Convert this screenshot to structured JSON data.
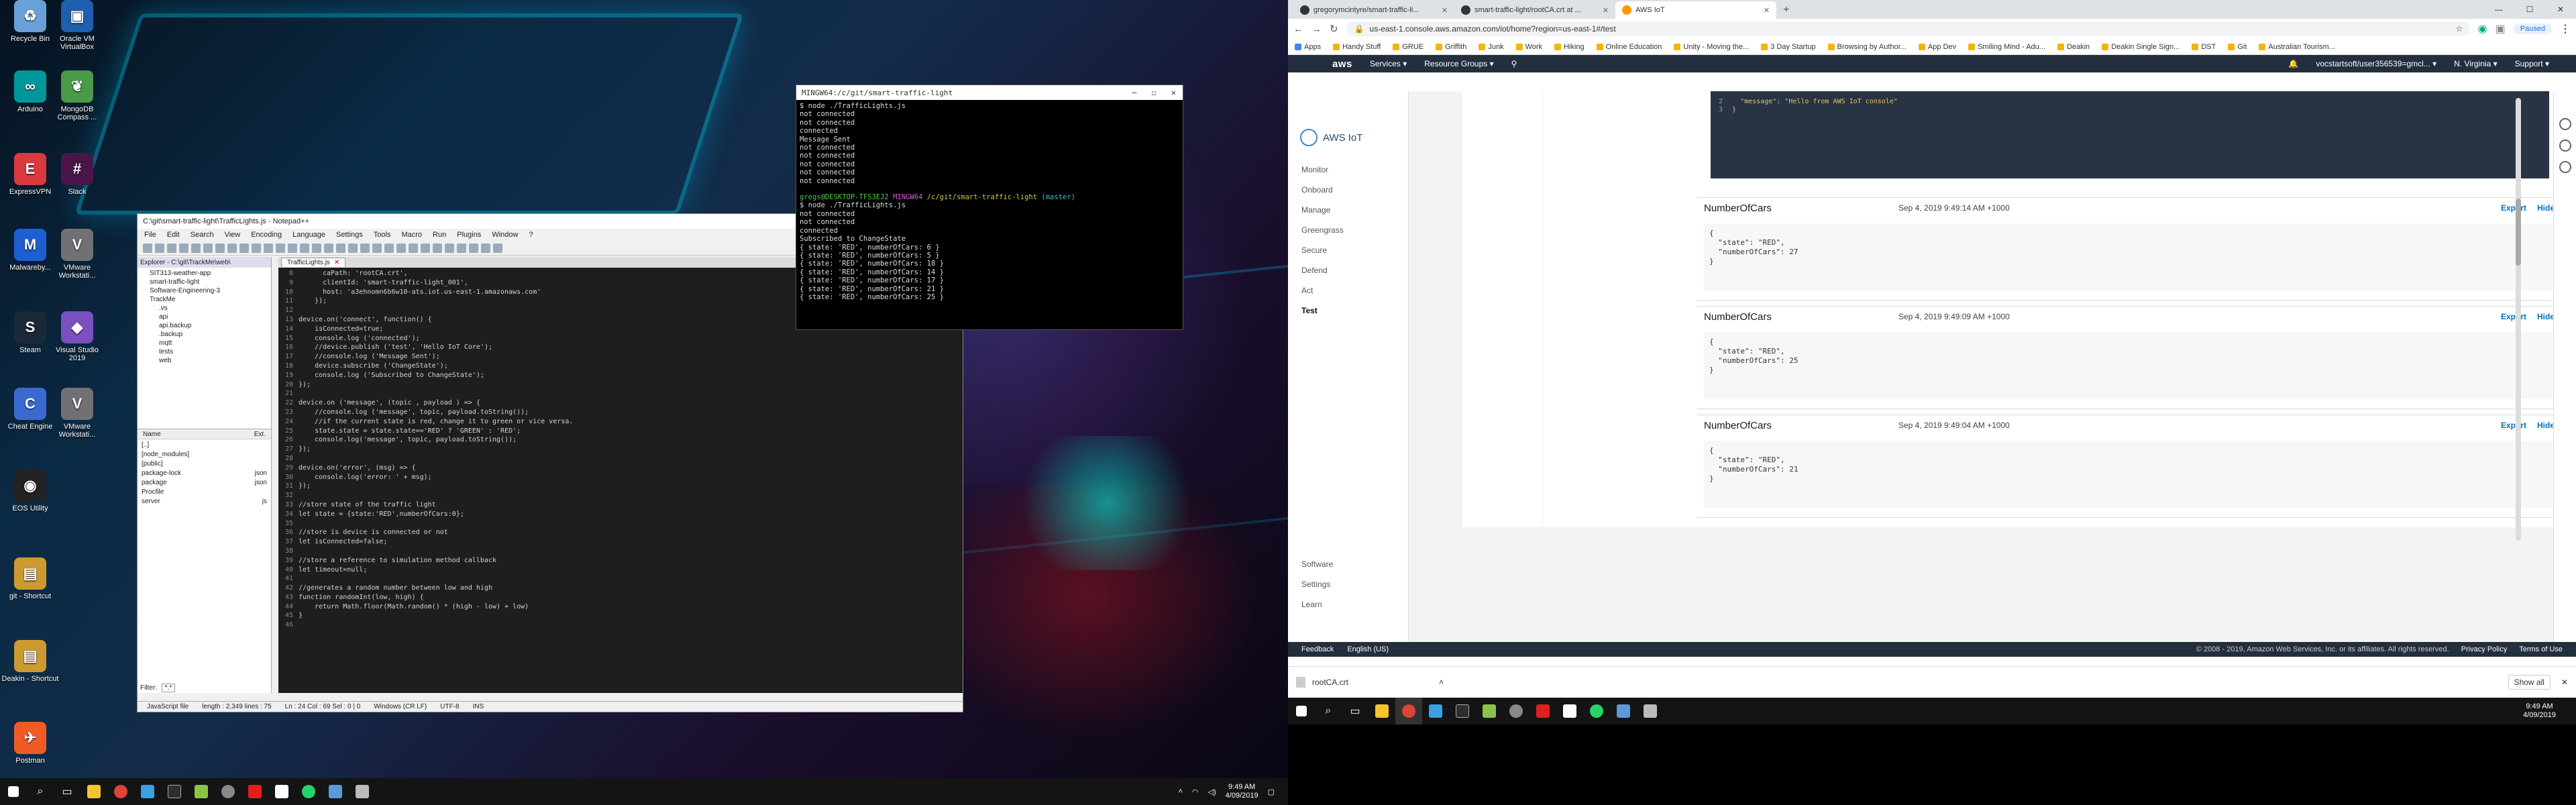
{
  "desktop": {
    "icons": [
      {
        "label": "Recycle Bin",
        "color": "#6aa0d8",
        "glyph": "♻"
      },
      {
        "label": "Oracle VM VirtualBox",
        "color": "#1f5fb0",
        "glyph": "▣"
      },
      {
        "label": "Arduino",
        "color": "#00979c",
        "glyph": "∞"
      },
      {
        "label": "MongoDB Compass ...",
        "color": "#4a9a4a",
        "glyph": "❦"
      },
      {
        "label": "ExpressVPN",
        "color": "#da3940",
        "glyph": "E"
      },
      {
        "label": "Slack",
        "color": "#4a154b",
        "glyph": "#"
      },
      {
        "label": "Malwareby...",
        "color": "#1d5fd0",
        "glyph": "M"
      },
      {
        "label": "VMware Workstati...",
        "color": "#717074",
        "glyph": "V"
      },
      {
        "label": "Steam",
        "color": "#1b2838",
        "glyph": "S"
      },
      {
        "label": "Visual Studio 2019",
        "color": "#7a4fc0",
        "glyph": "◆"
      },
      {
        "label": "VMware Workstati...",
        "color": "#717074",
        "glyph": "V"
      },
      {
        "label": "Cheat Engine",
        "color": "#3a6ad0",
        "glyph": "C"
      },
      {
        "label": "EOS Utility",
        "color": "#222",
        "glyph": "◉"
      },
      {
        "label": "git - Shortcut",
        "color": "#cc9a30",
        "glyph": "▤"
      },
      {
        "label": "Deakin - Shortcut",
        "color": "#cc9a30",
        "glyph": "▤"
      },
      {
        "label": "Postman",
        "color": "#ef5b25",
        "glyph": "✈"
      }
    ]
  },
  "terminal": {
    "title": "MINGW64:/c/git/smart-traffic-light",
    "lines": [
      {
        "cls": "",
        "text": "$ node ./TrafficLights.js"
      },
      {
        "cls": "",
        "text": "not connected"
      },
      {
        "cls": "",
        "text": "not connected"
      },
      {
        "cls": "",
        "text": "connected"
      },
      {
        "cls": "",
        "text": "Message Sent"
      },
      {
        "cls": "",
        "text": "not connected"
      },
      {
        "cls": "",
        "text": "not connected"
      },
      {
        "cls": "",
        "text": "not connected"
      },
      {
        "cls": "",
        "text": "not connected"
      },
      {
        "cls": "",
        "text": "not connected"
      },
      {
        "cls": "",
        "text": ""
      },
      {
        "cls": "prompt",
        "user": "gregs@DESKTOP-TFS3EJ2",
        "shell": "MINGW64",
        "path": "/c/git/smart-traffic-light",
        "branch": "(master)"
      },
      {
        "cls": "",
        "text": "$ node ./TrafficLights.js"
      },
      {
        "cls": "",
        "text": "not connected"
      },
      {
        "cls": "",
        "text": "not connected"
      },
      {
        "cls": "",
        "text": "connected"
      },
      {
        "cls": "",
        "text": "Subscribed to ChangeState"
      },
      {
        "cls": "",
        "text": "{ state: 'RED', numberOfCars: 6 }"
      },
      {
        "cls": "",
        "text": "{ state: 'RED', numberOfCars: 5 }"
      },
      {
        "cls": "",
        "text": "{ state: 'RED', numberOfCars: 18 }"
      },
      {
        "cls": "",
        "text": "{ state: 'RED', numberOfCars: 14 }"
      },
      {
        "cls": "",
        "text": "{ state: 'RED', numberOfCars: 17 }"
      },
      {
        "cls": "",
        "text": "{ state: 'RED', numberOfCars: 21 }"
      },
      {
        "cls": "",
        "text": "{ state: 'RED', numberOfCars: 25 }"
      }
    ]
  },
  "notepad": {
    "title": "C:\\git\\smart-traffic-light\\TrafficLights.js - Notepad++",
    "menu": [
      "File",
      "Edit",
      "Search",
      "View",
      "Encoding",
      "Language",
      "Settings",
      "Tools",
      "Macro",
      "Run",
      "Plugins",
      "Window",
      "?"
    ],
    "explorer_title": "Explorer - C:\\git\\TrackMe\\web\\",
    "tab_label": "TrafficLights.js",
    "tree": [
      "SIT313-weather-app",
      "smart-traffic-light",
      "Software-Engineering-3",
      "TrackMe",
      ".vs",
      "api",
      "api.backup",
      ".backup",
      "mqtt",
      "tests",
      "web"
    ],
    "files_head": {
      "name": "Name",
      "ext": "Ext."
    },
    "files": [
      {
        "name": "[..]",
        "ext": ""
      },
      {
        "name": "[node_modules]",
        "ext": ""
      },
      {
        "name": "[public]",
        "ext": ""
      },
      {
        "name": "package-lock",
        "ext": "json"
      },
      {
        "name": "package",
        "ext": "json"
      },
      {
        "name": "Procfile",
        "ext": ""
      },
      {
        "name": "server",
        "ext": "js"
      }
    ],
    "filter_label": "Filter:",
    "filter_value": "*.*",
    "code": [
      {
        "n": "8",
        "t": "      caPath: 'rootCA.crt',"
      },
      {
        "n": "9",
        "t": "      clientId: 'smart-traffic-light_001',"
      },
      {
        "n": "10",
        "t": "      host: 'a3ehnomn6b6w10-ats.iot.us-east-1.amazonaws.com'"
      },
      {
        "n": "11",
        "t": "    });"
      },
      {
        "n": "12",
        "t": ""
      },
      {
        "n": "13",
        "t": "device.on('connect', function() {"
      },
      {
        "n": "14",
        "t": "    isConnected=true;"
      },
      {
        "n": "15",
        "t": "    console.log ('connected');"
      },
      {
        "n": "16",
        "t": "    //device.publish ('test', 'Hello IoT Core');"
      },
      {
        "n": "17",
        "t": "    //console.log ('Message Sent');"
      },
      {
        "n": "18",
        "t": "    device.subscribe ('ChangeState');"
      },
      {
        "n": "19",
        "t": "    console.log ('Subscribed to ChangeState');"
      },
      {
        "n": "20",
        "t": "});"
      },
      {
        "n": "21",
        "t": ""
      },
      {
        "n": "22",
        "t": "device.on ('message', (topic , payload ) => {"
      },
      {
        "n": "23",
        "t": "    //console.log ('message', topic, payload.toString());"
      },
      {
        "n": "24",
        "t": "    //if the current state is red, change it to green or vice versa."
      },
      {
        "n": "25",
        "t": "    state.state = state.state=='RED' ? 'GREEN' : 'RED';"
      },
      {
        "n": "26",
        "t": "    console.log('message', topic, payload.toString());"
      },
      {
        "n": "27",
        "t": "});"
      },
      {
        "n": "28",
        "t": ""
      },
      {
        "n": "29",
        "t": "device.on('error', (msg) => {"
      },
      {
        "n": "30",
        "t": "    console.log('error: ' + msg);"
      },
      {
        "n": "31",
        "t": "});"
      },
      {
        "n": "32",
        "t": ""
      },
      {
        "n": "33",
        "t": "//store state of the traffic light"
      },
      {
        "n": "34",
        "t": "let state = {state:'RED',numberOfCars:0};"
      },
      {
        "n": "35",
        "t": ""
      },
      {
        "n": "36",
        "t": "//store is device is connected or not"
      },
      {
        "n": "37",
        "t": "let isConnected=false;"
      },
      {
        "n": "38",
        "t": ""
      },
      {
        "n": "39",
        "t": "//store a reference to simulation method callback"
      },
      {
        "n": "40",
        "t": "let timeout=null;"
      },
      {
        "n": "41",
        "t": ""
      },
      {
        "n": "42",
        "t": "//generates a random number between low and high"
      },
      {
        "n": "43",
        "t": "function randomInt(low, high) {"
      },
      {
        "n": "44",
        "t": "    return Math.floor(Math.random() * (high - low) + low)"
      },
      {
        "n": "45",
        "t": "}"
      },
      {
        "n": "46",
        "t": ""
      }
    ],
    "status": [
      "JavaScript file",
      "length : 2,349    lines : 75",
      "Ln : 24    Col : 69    Sel : 0 | 0",
      "Windows (CR LF)",
      "UTF-8",
      "INS"
    ]
  },
  "taskbar_left": {
    "time": "9:49 AM",
    "date": "4/09/2019"
  },
  "chrome": {
    "tabs": [
      {
        "label": "gregorymcintyre/smart-traffic-li...",
        "active": false
      },
      {
        "label": "smart-traffic-light/rootCA.crt at ...",
        "active": false
      },
      {
        "label": "AWS IoT",
        "active": true
      }
    ],
    "url": "us-east-1.console.aws.amazon.com/iot/home?region=us-east-1#/test",
    "paused": "Paused",
    "bookmarks": [
      "Apps",
      "Handy Stuff",
      "GRUE",
      "Griffith",
      "Junk",
      "Work",
      "Hiking",
      "Online Education",
      "Unity - Moving the...",
      "3 Day Startup",
      "Browsing by Author...",
      "App Dev",
      "Smiling Mind - Adu...",
      "Deakin",
      "Deakin Single Sign...",
      "DST",
      "Git",
      "Australian Tourism..."
    ]
  },
  "aws": {
    "nav": {
      "logo": "aws",
      "services": "Services ▾",
      "resource_groups": "Resource Groups ▾",
      "account": "vocstartsoft/user356539=gmcl...  ▾",
      "region": "N. Virginia ▾",
      "support": "Support ▾"
    },
    "sidebar": {
      "brand": "AWS IoT",
      "items": [
        "Monitor",
        "Onboard",
        "Manage",
        "Greengrass",
        "Secure",
        "Defend",
        "Act",
        "Test"
      ],
      "active": "Test",
      "bottom": [
        "Software",
        "Settings",
        "Learn"
      ]
    },
    "payload_preview": [
      {
        "n": "2",
        "t": "  \"message\": \"Hello from AWS IoT console\""
      },
      {
        "n": "3",
        "t": "}"
      }
    ],
    "messages": [
      {
        "topic": "NumberOfCars",
        "date": "Sep 4, 2019 9:49:14 AM +1000",
        "body": "{\n  \"state\": \"RED\",\n  \"numberOfCars\": 27\n}"
      },
      {
        "topic": "NumberOfCars",
        "date": "Sep 4, 2019 9:49:09 AM +1000",
        "body": "{\n  \"state\": \"RED\",\n  \"numberOfCars\": 25\n}"
      },
      {
        "topic": "NumberOfCars",
        "date": "Sep 4, 2019 9:49:04 AM +1000",
        "body": "{\n  \"state\": \"RED\",\n  \"numberOfCars\": 21\n}"
      }
    ],
    "export_label": "Export",
    "hide_label": "Hide",
    "footer": {
      "feedback": "Feedback",
      "language": "English (US)",
      "copyright": "© 2008 - 2019, Amazon Web Services, Inc. or its affiliates. All rights reserved.",
      "privacy": "Privacy Policy",
      "terms": "Terms of Use"
    }
  },
  "download_bar": {
    "file": "rootCA.crt",
    "show_all": "Show all"
  },
  "taskbar_right": {
    "time": "9:49 AM",
    "date": "4/09/2019"
  }
}
